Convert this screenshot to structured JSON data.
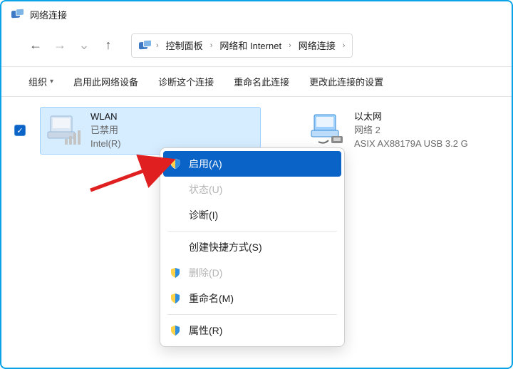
{
  "window": {
    "title": "网络连接"
  },
  "breadcrumb": {
    "root_sep": "›",
    "seg1": "控制面板",
    "seg2": "网络和 Internet",
    "seg3": "网络连接",
    "sep": "›"
  },
  "toolbar": {
    "organize": "组织",
    "enable_device": "启用此网络设备",
    "diagnose": "诊断这个连接",
    "rename": "重命名此连接",
    "change_settings": "更改此连接的设置"
  },
  "adapters": {
    "wlan": {
      "name": "WLAN",
      "status": "已禁用",
      "driver": "Intel(R) "
    },
    "ethernet": {
      "name": "以太网",
      "status": "网络 2",
      "driver": "ASIX AX88179A USB 3.2 G"
    }
  },
  "context_menu": {
    "enable": "启用(A)",
    "status": "状态(U)",
    "diagnose": "诊断(I)",
    "create_shortcut": "创建快捷方式(S)",
    "delete": "删除(D)",
    "rename": "重命名(M)",
    "properties": "属性(R)"
  },
  "glyphs": {
    "check": "✓",
    "back": "←",
    "forward": "→",
    "chev_down": "⌄",
    "up": "↑"
  }
}
